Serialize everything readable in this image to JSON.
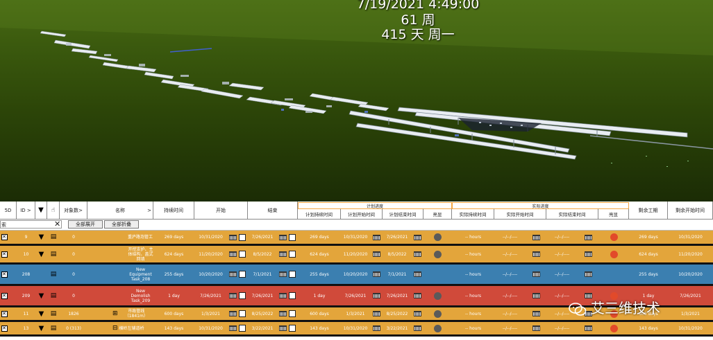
{
  "hud": {
    "date_time": "7/19/2021 4:49:00",
    "week": "61 周",
    "day": "415 天 周一"
  },
  "grid": {
    "headers": {
      "c5d": "5D",
      "id": "ID",
      "id_arrow": ">",
      "obj_count": "对象数",
      "obj_arrow": ">",
      "name": "名称",
      "name_arrow": ">",
      "duration": "持续时间",
      "start": "开始",
      "end": "结束",
      "planned_group": "计划进度",
      "planned_duration": "计划持续时间",
      "planned_start": "计划开始时间",
      "planned_end": "计划结束时间",
      "highlight1": "亮显",
      "actual_group": "实际进度",
      "actual_duration": "实际持续时间",
      "actual_start": "实际开始时间",
      "actual_end": "实际结束时间",
      "highlight2": "亮显",
      "remaining_work": "剩余工期",
      "remaining_start": "剩余开始时间"
    },
    "filter": {
      "value": "索",
      "clear": "✕",
      "expand_all": "全部展开",
      "collapse_all": "全部折叠"
    },
    "rows": [
      {
        "id": "9",
        "obj": "0",
        "name": "重庐路泡管工",
        "duration": "269 days",
        "start": "10/31/2020",
        "end": "7/26/2021",
        "p_dur": "269 days",
        "p_start": "10/31/2020",
        "p_end": "7/26/2021",
        "a_dur": "-- hours",
        "a_start": "--/--/----",
        "a_end": "--/--/----",
        "rem": "269 days",
        "rem_start": "10/31/2020",
        "color": "#e3a53b"
      },
      {
        "id": "10",
        "obj": "0",
        "name": "开挖支护、主体结构、盖式回填",
        "duration": "624 days",
        "start": "11/20/2020",
        "end": "8/5/2022",
        "p_dur": "624 days",
        "p_start": "11/20/2020",
        "p_end": "8/5/2022",
        "a_dur": "-- hours",
        "a_start": "--/--/----",
        "a_end": "--/--/----",
        "rem": "624 days",
        "rem_start": "11/20/2020",
        "color": "#e3a53b"
      },
      {
        "id": "208",
        "obj": "0",
        "name": "New Equipment Task_208",
        "duration": "255 days",
        "start": "10/20/2020",
        "end": "7/1/2021",
        "p_dur": "255 days",
        "p_start": "10/20/2020",
        "p_end": "7/1/2021",
        "a_dur": "-- hours",
        "a_start": "--/--/----",
        "a_end": "--/--/----",
        "rem": "255 days",
        "rem_start": "10/20/2020",
        "color": "#3b7fb0"
      },
      {
        "id": "209",
        "obj": "0",
        "name": "New Demolish Task_209",
        "duration": "1 day",
        "start": "7/26/2021",
        "end": "7/26/2021",
        "p_dur": "1 day",
        "p_start": "7/26/2021",
        "p_end": "7/26/2021",
        "a_dur": "-- hours",
        "a_start": "--/--/----",
        "a_end": "--/--/----",
        "rem": "1 day",
        "rem_start": "7/26/2021",
        "color": "#d04a3a"
      },
      {
        "id": "11",
        "obj": "1826",
        "name": "市政管线（1841m）",
        "duration": "600 days",
        "start": "1/3/2021",
        "end": "8/25/2022",
        "p_dur": "600 days",
        "p_start": "1/3/2021",
        "p_end": "8/25/2022",
        "a_dur": "-- hours",
        "a_start": "--/--/----",
        "a_end": "--/--/----",
        "rem": "600 days",
        "rem_start": "1/3/2021",
        "color": "#e3a53b"
      },
      {
        "id": "13",
        "obj": "0 (313)",
        "name": "横岭左辅道桥",
        "duration": "143 days",
        "start": "10/31/2020",
        "end": "3/22/2021",
        "p_dur": "143 days",
        "p_start": "10/31/2020",
        "p_end": "3/22/2021",
        "a_dur": "-- hours",
        "a_start": "--/--/----",
        "a_end": "--/--/----",
        "rem": "143 days",
        "rem_start": "10/31/2020",
        "color": "#e3a53b"
      }
    ]
  },
  "watermark": {
    "text": "艾三维技术"
  },
  "colors": {
    "orange": "#e3a53b",
    "blue": "#3b7fb0",
    "red": "#d04a3a",
    "terrain": "#2c4508"
  }
}
